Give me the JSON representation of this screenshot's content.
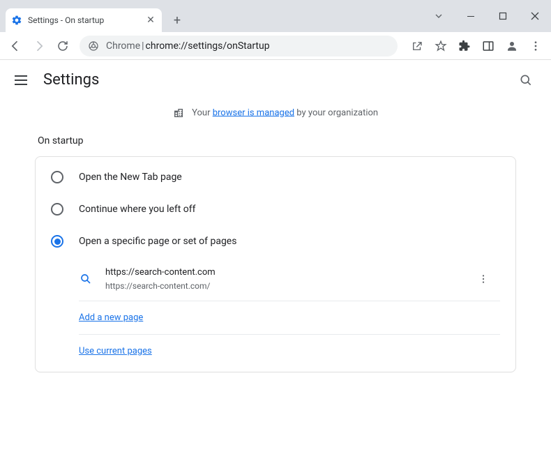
{
  "tab": {
    "title": "Settings - On startup"
  },
  "omnibox": {
    "prefix": "Chrome",
    "url": "chrome://settings/onStartup"
  },
  "settings": {
    "title": "Settings"
  },
  "banner": {
    "prefix": "Your ",
    "link": "browser is managed",
    "suffix": " by your organization"
  },
  "section": {
    "title": "On startup"
  },
  "options": {
    "newtab": "Open the New Tab page",
    "continue": "Continue where you left off",
    "specific": "Open a specific page or set of pages"
  },
  "page": {
    "title": "https://search-content.com",
    "url": "https://search-content.com/"
  },
  "links": {
    "add": "Add a new page",
    "current": "Use current pages"
  }
}
